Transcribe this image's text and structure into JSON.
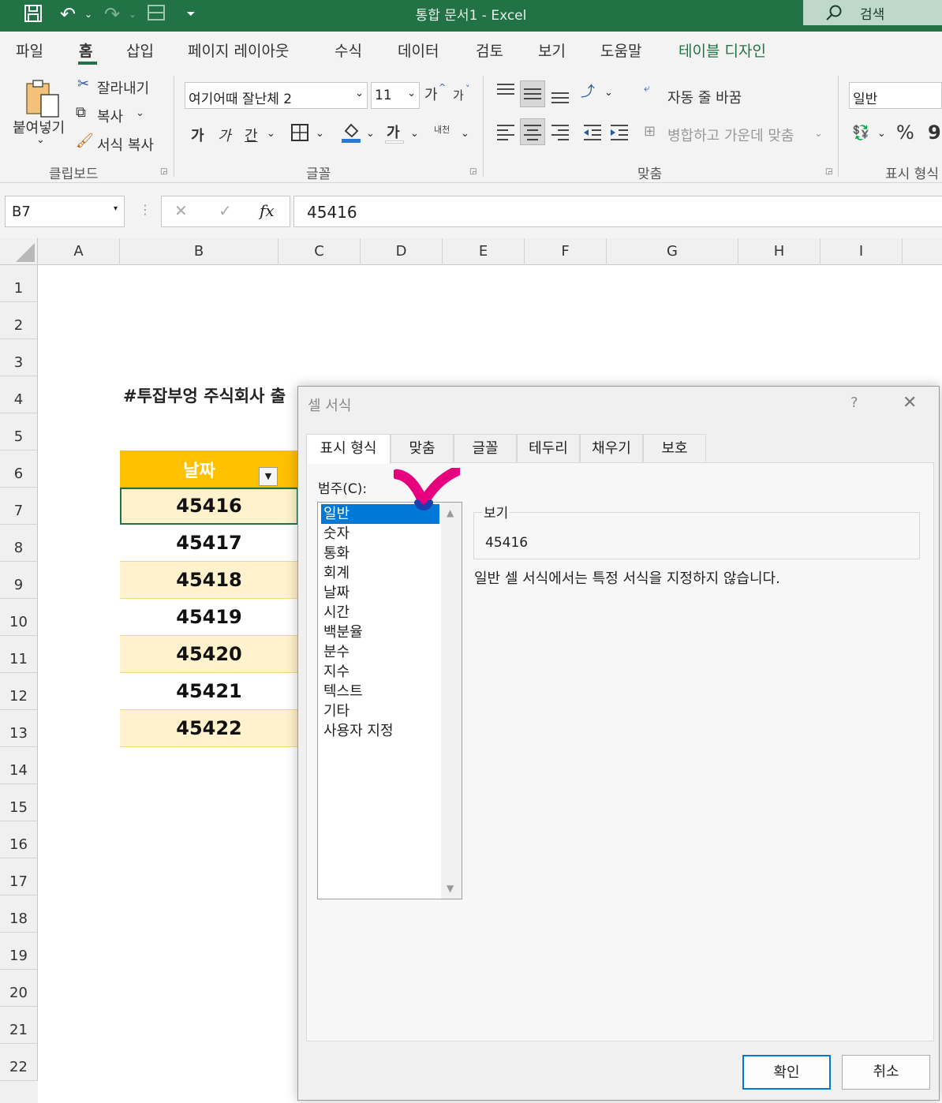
{
  "titlebar": {
    "title": "통합 문서1  -  Excel",
    "search_label": "검색"
  },
  "menu": {
    "tabs": [
      "파일",
      "홈",
      "삽입",
      "페이지 레이아웃",
      "수식",
      "데이터",
      "검토",
      "보기",
      "도움말",
      "테이블 디자인"
    ],
    "active": "홈"
  },
  "ribbon": {
    "clipboard": {
      "paste": "붙여넣기",
      "cut": "잘라내기",
      "copy": "복사",
      "format_painter": "서식 복사",
      "group": "클립보드"
    },
    "font": {
      "name": "여기어때 잘난체 2",
      "size": "11",
      "grow": "가",
      "shrink": "가",
      "bold": "가",
      "italic": "가",
      "underline": "간",
      "fontcolor": "가",
      "phonetic": "내천",
      "group": "글꼴"
    },
    "align": {
      "wrap": "자동 줄 바꿈",
      "merge": "병합하고 가운데 맞춤",
      "group": "맞춤"
    },
    "number": {
      "format": "일반",
      "percent": "%",
      "comma": "9",
      "group": "표시 형식"
    }
  },
  "formula_bar": {
    "name_box": "B7",
    "fx": "fx",
    "value": "45416"
  },
  "columns": [
    "A",
    "B",
    "C",
    "D",
    "E",
    "F",
    "G",
    "H",
    "I"
  ],
  "rows": [
    "1",
    "2",
    "3",
    "4",
    "5",
    "6",
    "7",
    "8",
    "9",
    "10",
    "11",
    "12",
    "13",
    "14",
    "15",
    "16",
    "17",
    "18",
    "19",
    "20",
    "21",
    "22"
  ],
  "sheet": {
    "heading": "#투잡부엉 주식회사 출",
    "table_header": "날짜",
    "values": [
      "45416",
      "45417",
      "45418",
      "45419",
      "45420",
      "45421",
      "45422"
    ]
  },
  "dialog": {
    "title": "셀 서식",
    "help": "?",
    "tabs": [
      "표시 형식",
      "맞춤",
      "글꼴",
      "테두리",
      "채우기",
      "보호"
    ],
    "category_label": "범주(C):",
    "categories": [
      "일반",
      "숫자",
      "통화",
      "회계",
      "날짜",
      "시간",
      "백분율",
      "분수",
      "지수",
      "텍스트",
      "기타",
      "사용자 지정"
    ],
    "selected_category": "일반",
    "preview_label": "보기",
    "preview_value": "45416",
    "description": "일반 셀 서식에서는 특정 서식을 지정하지 않습니다.",
    "ok": "확인",
    "cancel": "취소"
  },
  "colors": {
    "excel_green": "#217346",
    "table_header": "#ffc000",
    "band": "#fff2cc",
    "selection": "#0078d7",
    "annotation": "#e6007e"
  }
}
